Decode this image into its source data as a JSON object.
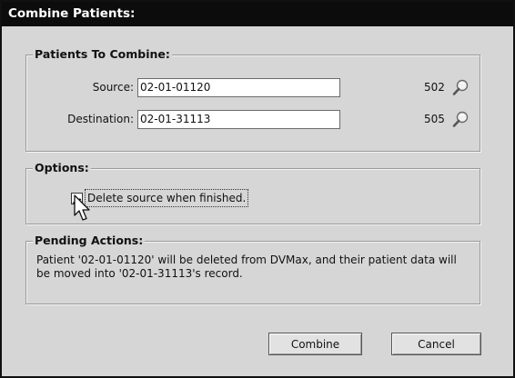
{
  "window": {
    "title": "Combine Patients:"
  },
  "patients_group": {
    "title": "Patients To Combine:",
    "source": {
      "label": "Source:",
      "value": "02-01-01120",
      "id": "502",
      "lookup_icon": "magnifier-icon"
    },
    "destination": {
      "label": "Destination:",
      "value": "02-01-31113",
      "id": "505",
      "lookup_icon": "magnifier-icon"
    }
  },
  "options_group": {
    "title": "Options:",
    "delete_source": {
      "label": "Delete source when finished.",
      "checked": true
    }
  },
  "pending_group": {
    "title": "Pending Actions:",
    "message": "Patient '02-01-01120' will be deleted from DVMax, and their patient data will be moved into '02-01-31113's record."
  },
  "buttons": {
    "combine": "Combine",
    "cancel": "Cancel"
  },
  "colors": {
    "title_bar": "#0c0c0c",
    "dialog_bg": "#d6d6d6"
  }
}
